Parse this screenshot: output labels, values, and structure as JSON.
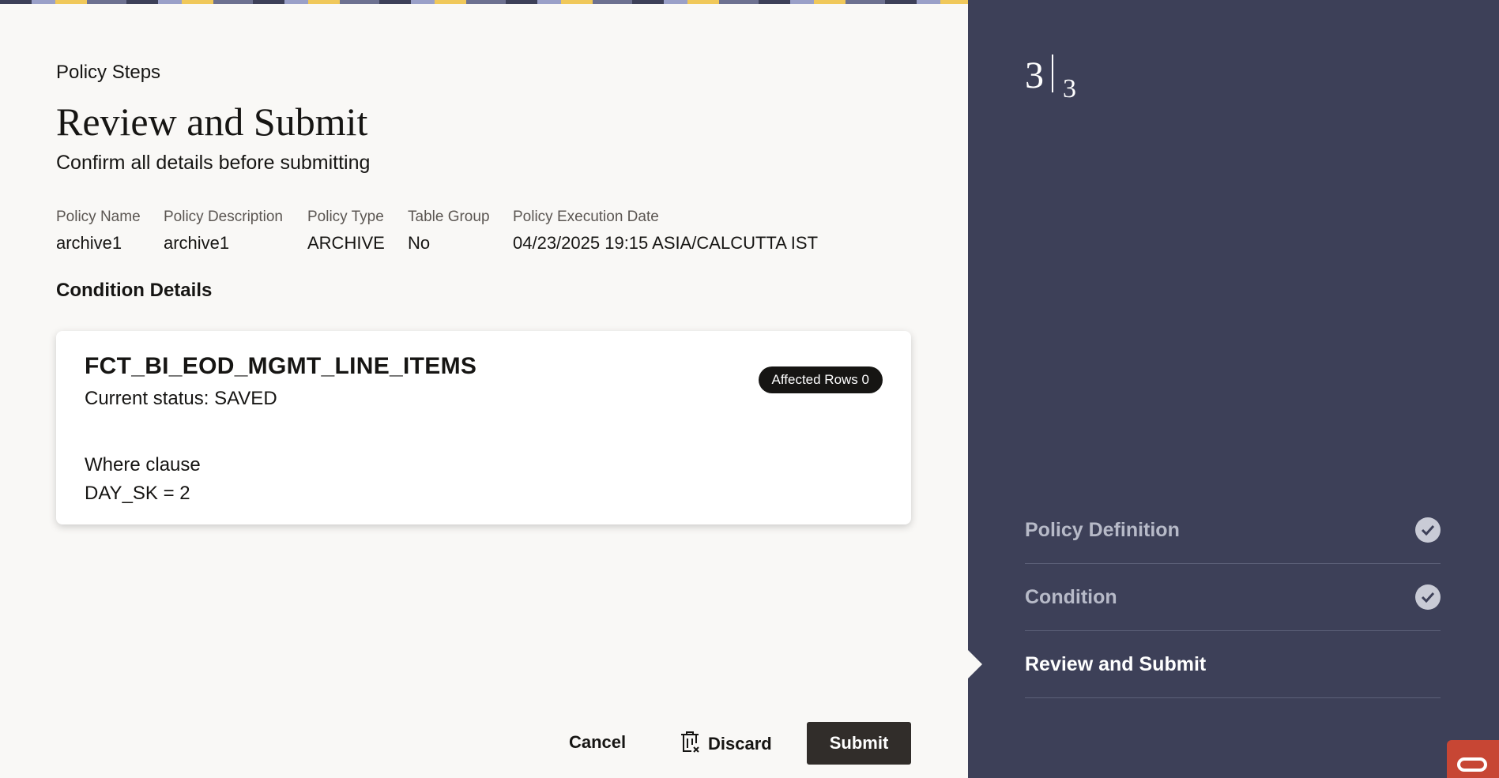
{
  "header": {
    "kicker": "Policy Steps",
    "title": "Review and Submit",
    "subtitle": "Confirm all details before submitting"
  },
  "summary": [
    {
      "label": "Policy Name",
      "value": "archive1"
    },
    {
      "label": "Policy Description",
      "value": "archive1"
    },
    {
      "label": "Policy Type",
      "value": "ARCHIVE"
    },
    {
      "label": "Table Group",
      "value": "No"
    },
    {
      "label": "Policy Execution Date",
      "value": "04/23/2025 19:15 ASIA/CALCUTTA IST"
    }
  ],
  "conditions": {
    "heading": "Condition Details",
    "card": {
      "table": "FCT_BI_EOD_MGMT_LINE_ITEMS",
      "status": "Current status: SAVED",
      "badge": "Affected Rows 0",
      "where_label": "Where clause",
      "where_clause": "DAY_SK = 2"
    }
  },
  "actions": {
    "cancel": "Cancel",
    "discard": "Discard",
    "submit": "Submit"
  },
  "progress": {
    "current": "3",
    "total": "3",
    "steps": [
      {
        "label": "Policy Definition",
        "completed": true
      },
      {
        "label": "Condition",
        "completed": true
      },
      {
        "label": "Review and Submit",
        "completed": false,
        "active": true
      }
    ]
  },
  "icons": {
    "discard": "trash-icon",
    "step_complete": "check-circle-icon",
    "brand": "oracle-logo-icon"
  },
  "colors": {
    "sidebar": "#3d4058",
    "primary_button": "#312d2a",
    "badge": "#161513",
    "brand": "#c74634"
  }
}
